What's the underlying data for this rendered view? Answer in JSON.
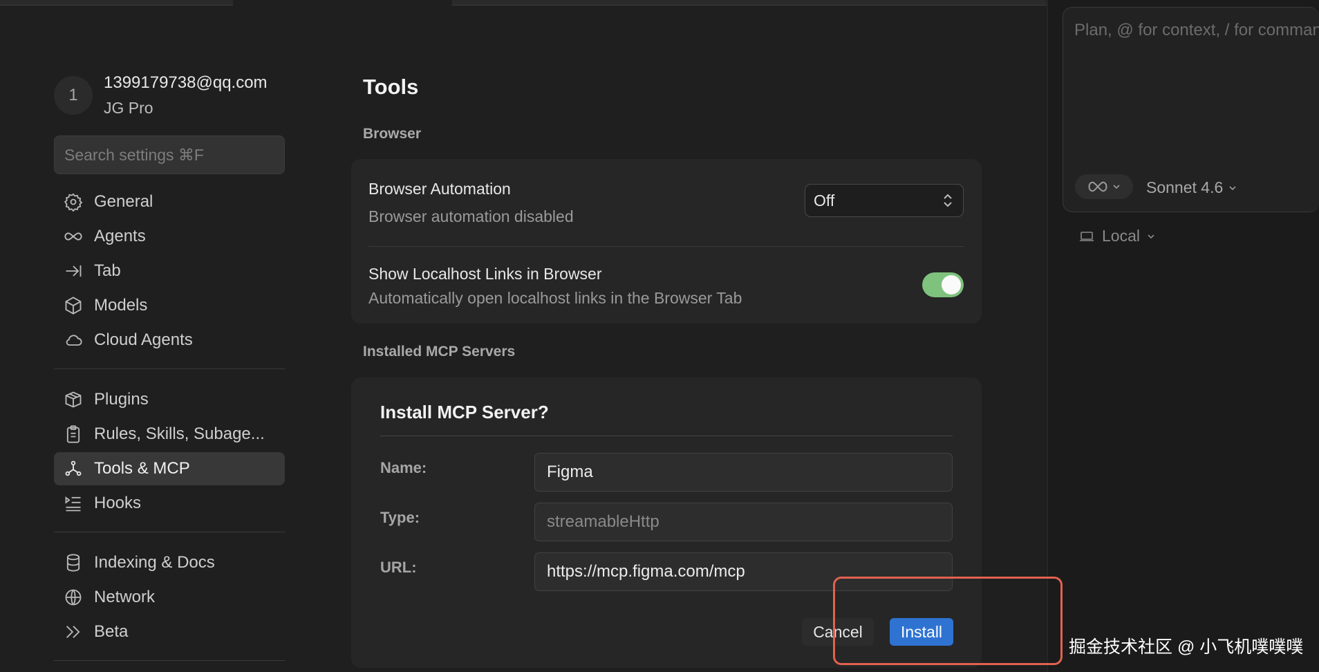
{
  "account": {
    "avatar_initial": "1",
    "email": "1399179738@qq.com",
    "plan": "JG Pro"
  },
  "search": {
    "placeholder": "Search settings ⌘F"
  },
  "sidebar": {
    "items": [
      {
        "label": "General",
        "icon": "gear-icon"
      },
      {
        "label": "Agents",
        "icon": "infinity-icon"
      },
      {
        "label": "Tab",
        "icon": "arrow-to-line-icon"
      },
      {
        "label": "Models",
        "icon": "cube-icon"
      },
      {
        "label": "Cloud Agents",
        "icon": "cloud-icon"
      },
      {
        "label": "Plugins",
        "icon": "package-icon"
      },
      {
        "label": "Rules, Skills, Subage...",
        "icon": "clipboard-icon"
      },
      {
        "label": "Tools & MCP",
        "icon": "network-nodes-icon",
        "active": true
      },
      {
        "label": "Hooks",
        "icon": "list-indent-icon"
      },
      {
        "label": "Indexing & Docs",
        "icon": "database-icon"
      },
      {
        "label": "Network",
        "icon": "globe-icon"
      },
      {
        "label": "Beta",
        "icon": "double-chevron-icon"
      }
    ]
  },
  "main": {
    "title": "Tools",
    "browser_section": "Browser",
    "browser_automation": {
      "title": "Browser Automation",
      "subtitle": "Browser automation disabled",
      "value": "Off"
    },
    "localhost_links": {
      "title": "Show Localhost Links in Browser",
      "subtitle": "Automatically open localhost links in the Browser Tab",
      "enabled": true
    },
    "mcp_section": "Installed MCP Servers"
  },
  "dialog": {
    "title": "Install MCP Server?",
    "name_label": "Name:",
    "name_value": "Figma",
    "type_label": "Type:",
    "type_value": "streamableHttp",
    "url_label": "URL:",
    "url_value": "https://mcp.figma.com/mcp",
    "cancel_label": "Cancel",
    "install_label": "Install"
  },
  "composer": {
    "placeholder": "Plan, @ for context, / for commands",
    "model": "Sonnet 4.6",
    "location": "Local"
  },
  "watermark": "掘金技术社区 @ 小飞机噗噗噗",
  "colors": {
    "accent": "#2f73d2",
    "toggle_on": "#7fc27d",
    "highlight": "#e2624f"
  }
}
